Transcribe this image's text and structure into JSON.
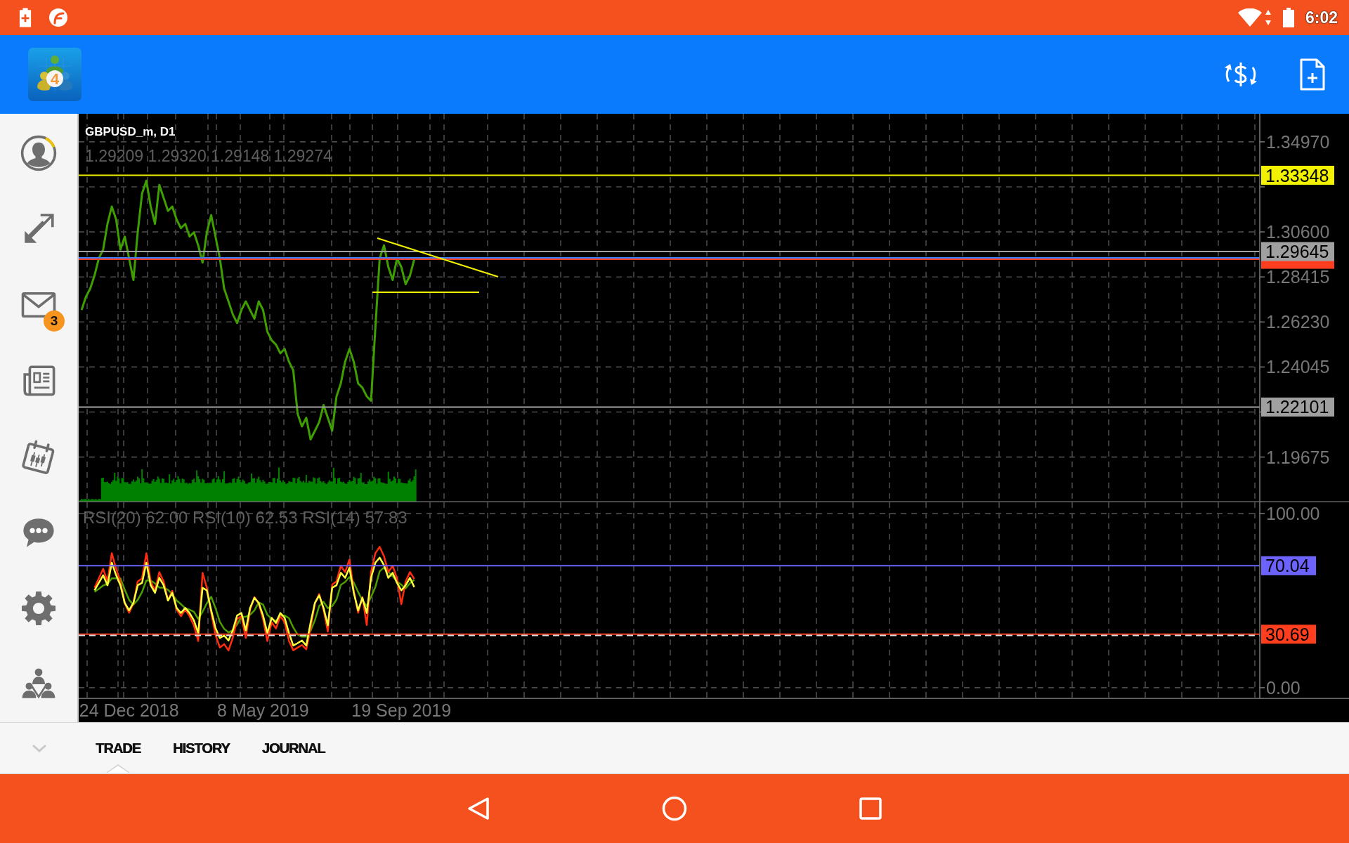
{
  "status_bar": {
    "time": "6:02"
  },
  "app_bar": {
    "logo_text": "4"
  },
  "sidebar": {
    "items": [
      {
        "kind": "account"
      },
      {
        "kind": "trade"
      },
      {
        "kind": "mail",
        "badge": "3"
      },
      {
        "kind": "news"
      },
      {
        "kind": "calendar"
      },
      {
        "kind": "chat"
      },
      {
        "kind": "settings"
      },
      {
        "kind": "community"
      }
    ]
  },
  "price_chart": {
    "ohlc": "1.29209 1.29320 1.29148 1.29274",
    "chart_data": {
      "type": "line",
      "title": "GBPUSD_m, D1",
      "grid": true,
      "ylim": [
        1.1748,
        1.3633
      ],
      "yticks": [
        {
          "value": 1.3497,
          "label": "1.34970"
        },
        {
          "value": 1.306,
          "label": "1.30600"
        },
        {
          "value": 1.28415,
          "label": "1.28415"
        },
        {
          "value": 1.2623,
          "label": "1.26230"
        },
        {
          "value": 1.24045,
          "label": "1.24045"
        },
        {
          "value": 1.19675,
          "label": "1.19675"
        }
      ],
      "categories": [
        null,
        null,
        null,
        null,
        null,
        null,
        null,
        null,
        null,
        null,
        null,
        null,
        null,
        null,
        null,
        null,
        null,
        null,
        null,
        null,
        null,
        null,
        null,
        null,
        null,
        null,
        null,
        null,
        null,
        null,
        null,
        null,
        null,
        null,
        null,
        null,
        null,
        null,
        null,
        null,
        null,
        null,
        null,
        null,
        null,
        null,
        null,
        null,
        null,
        null,
        null,
        null,
        null,
        null,
        null,
        null,
        null,
        null,
        null,
        null,
        null,
        null,
        null,
        null,
        null,
        null,
        null,
        null,
        null,
        null,
        null,
        null,
        null,
        null,
        null,
        null,
        null,
        null,
        null,
        null,
        null,
        null,
        null,
        null,
        null,
        null,
        null,
        null,
        null,
        null,
        null,
        null,
        null,
        null,
        null,
        null,
        null,
        null,
        null,
        null,
        null,
        null,
        null,
        null,
        null,
        null,
        null,
        null,
        null,
        null,
        null,
        null,
        null,
        null,
        null,
        null,
        null,
        null,
        null,
        null,
        null,
        null,
        null,
        null,
        null,
        null,
        null,
        null,
        null,
        null,
        null,
        null,
        null,
        null,
        null,
        null,
        null,
        null,
        null,
        null,
        null,
        null,
        null,
        null,
        null,
        null,
        null,
        null,
        null,
        null,
        null,
        null,
        null,
        null,
        null,
        null,
        null,
        null,
        null,
        null,
        null,
        null,
        null,
        null,
        null,
        null,
        null,
        null,
        null,
        null,
        null,
        null,
        null,
        null,
        null,
        null,
        null,
        null,
        null,
        null,
        null,
        null,
        null,
        null,
        null,
        null,
        null,
        null,
        null,
        null,
        null,
        null,
        null,
        null,
        null,
        null,
        null,
        null,
        null,
        null,
        null,
        null,
        null,
        null,
        null,
        null,
        null,
        null,
        null,
        null,
        null,
        null,
        null,
        null,
        null,
        null,
        null,
        null,
        null,
        null,
        null,
        null,
        null,
        null,
        null,
        null,
        null,
        null,
        null,
        null,
        null,
        null,
        null,
        null,
        null,
        null,
        null,
        null,
        null,
        null,
        null,
        null,
        null,
        null,
        null,
        null,
        null,
        null,
        null,
        null,
        null,
        null,
        null,
        null,
        null,
        null,
        null,
        null,
        null,
        null,
        null,
        null,
        null,
        null,
        null,
        null,
        null,
        null,
        null,
        null,
        null,
        null,
        null
      ],
      "series": [
        {
          "color": "#3f9f00",
          "values": [
            1.2681,
            1.2744,
            1.2785,
            1.2848,
            1.2932,
            1.2974,
            1.3099,
            1.3183,
            1.312,
            1.2974,
            1.3037,
            1.2932,
            1.2827,
            1.3058,
            1.3246,
            1.3309,
            1.3183,
            1.3099,
            1.3288,
            1.3225,
            1.3162,
            1.3183,
            1.312,
            1.3078,
            1.3099,
            1.3037,
            1.3058,
            1.2995,
            1.2911,
            1.3058,
            1.3141,
            1.3037,
            1.2932,
            1.2785,
            1.2723,
            1.266,
            1.2618,
            1.2681,
            1.2723,
            1.2681,
            1.2639,
            1.2723,
            1.2681,
            1.2576,
            1.2534,
            1.2513,
            1.2471,
            1.2492,
            1.243,
            1.2388,
            1.2178,
            1.2116,
            1.2158,
            1.2053,
            1.2095,
            1.2137,
            1.222,
            1.2158,
            1.2095,
            1.2262,
            1.2325,
            1.243,
            1.2492,
            1.243,
            1.2325,
            1.2304,
            1.2262,
            1.2241,
            1.2597,
            1.2932,
            1.2995,
            1.289,
            1.2827,
            1.2932,
            1.289,
            1.2806,
            1.2848,
            1.2927,
            null,
            null,
            null,
            null,
            null,
            null,
            null,
            null,
            null,
            null,
            null,
            null,
            null,
            null,
            null,
            null,
            null,
            null,
            null,
            null,
            null,
            null,
            null,
            null,
            null,
            null,
            null,
            null,
            null,
            null,
            null,
            null,
            null,
            null,
            null,
            null,
            null,
            null,
            null,
            null,
            null,
            null,
            null,
            null,
            null,
            null,
            null,
            null,
            null,
            null,
            null,
            null,
            null,
            null,
            null,
            null,
            null,
            null,
            null,
            null,
            null,
            null,
            null,
            null,
            null,
            null,
            null,
            null,
            null,
            null,
            null,
            null,
            null,
            null,
            null,
            null,
            null,
            null,
            null,
            null,
            null,
            null,
            null,
            null,
            null,
            null,
            null,
            null,
            null,
            null,
            null,
            null,
            null,
            null,
            null,
            null,
            null,
            null,
            null,
            null,
            null,
            null,
            null,
            null,
            null,
            null,
            null,
            null,
            null,
            null,
            null,
            null,
            null,
            null,
            null,
            null,
            null,
            null,
            null,
            null,
            null,
            null,
            null,
            null,
            null,
            null,
            null,
            null,
            null,
            null,
            null,
            null,
            null,
            null,
            null,
            null,
            null,
            null,
            null,
            null,
            null,
            null,
            null,
            null,
            null,
            null,
            null,
            null,
            null,
            null,
            null,
            null,
            null,
            null,
            null,
            null,
            null,
            null,
            null,
            null,
            null,
            null,
            null,
            null,
            null,
            null,
            null,
            null,
            null,
            null,
            null,
            null,
            null,
            null,
            null,
            null,
            null,
            null,
            null,
            null,
            null,
            null,
            null,
            null,
            null,
            null,
            null,
            null,
            null,
            null,
            null,
            null,
            null,
            null,
            null
          ]
        }
      ],
      "ref_lines": [
        {
          "axis": "y",
          "value": 1.33348,
          "color": "#f2f200",
          "label": "1.33348"
        },
        {
          "axis": "y",
          "value": 1.2934,
          "color": "#3a7bff"
        },
        {
          "axis": "y",
          "value": 1.29274,
          "color": "#ff3d1f"
        },
        {
          "axis": "y",
          "value": 1.29645,
          "color": "#a0a0a0",
          "label": "1.29645"
        },
        {
          "axis": "y",
          "value": 1.22101,
          "color": "#a0a0a0",
          "label": "1.22101"
        }
      ]
    }
  },
  "indicator_chart": {
    "chart_data": {
      "type": "line",
      "title": "RSI(20) 62.00 RSI(10) 62.53 RSI(14) 57.83",
      "grid": true,
      "ylim": [
        -6.5,
        106.5
      ],
      "yticks": [
        {
          "value": 100,
          "label": "100.00"
        },
        {
          "value": 0,
          "label": "0.00"
        }
      ],
      "categories": [
        null,
        null,
        null,
        null,
        null,
        null,
        null,
        null,
        null,
        null,
        null,
        "24 Dec 2018",
        null,
        null,
        null,
        null,
        null,
        null,
        null,
        null,
        null,
        null,
        null,
        null,
        null,
        null,
        null,
        null,
        null,
        null,
        null,
        null,
        null,
        null,
        null,
        null,
        null,
        null,
        null,
        null,
        null,
        null,
        "8 May 2019",
        null,
        null,
        null,
        null,
        null,
        null,
        null,
        null,
        null,
        null,
        null,
        null,
        null,
        null,
        null,
        null,
        null,
        null,
        null,
        null,
        null,
        null,
        null,
        null,
        null,
        null,
        null,
        null,
        null,
        null,
        null,
        "19 Sep 2019",
        null,
        null,
        null,
        null,
        null,
        null,
        null,
        null,
        null,
        null,
        null,
        null,
        null,
        null,
        null,
        null,
        null,
        null,
        null,
        null,
        null,
        null,
        null,
        null,
        null,
        null,
        null,
        null,
        null,
        null,
        null,
        null,
        null,
        null,
        null,
        null,
        null,
        null,
        null,
        null,
        null,
        null,
        null,
        null,
        null,
        null,
        null,
        null,
        null,
        null,
        null,
        null,
        null,
        null,
        null,
        null,
        null,
        null,
        null,
        null,
        null,
        null,
        null,
        null,
        null,
        null,
        null,
        null,
        null,
        null,
        null,
        null,
        null,
        null,
        null,
        null,
        null,
        null,
        null,
        null,
        null,
        null,
        null,
        null,
        null,
        null,
        null,
        null,
        null,
        null,
        null,
        null,
        null,
        null,
        null,
        null,
        null,
        null,
        null,
        null,
        null,
        null,
        null,
        null,
        null,
        null,
        null,
        null,
        null,
        null,
        null,
        null,
        null,
        null,
        null,
        null,
        null,
        null,
        null,
        null,
        null,
        null,
        null,
        null,
        null,
        null,
        null,
        null,
        null,
        null,
        null,
        null,
        null,
        null,
        null,
        null,
        null,
        null,
        null,
        null,
        null,
        null,
        null,
        null,
        null,
        null,
        null,
        null,
        null,
        null,
        null,
        null,
        null,
        null,
        null,
        null,
        null,
        null,
        null,
        null,
        null,
        null,
        null,
        null,
        null,
        null,
        null,
        null,
        null,
        null,
        null,
        null,
        null,
        null,
        null,
        null,
        null,
        null,
        null,
        null,
        null,
        null,
        null,
        null,
        null,
        null,
        null,
        null,
        null,
        null,
        null,
        null,
        null,
        null,
        null,
        null,
        null,
        null
      ],
      "series": [
        {
          "color": "#4d9e00",
          "values": [
            null,
            null,
            null,
            55.0,
            56.8,
            58.7,
            59.5,
            62.8,
            62.8,
            62.8,
            56.3,
            50.5,
            47.7,
            50.5,
            55.0,
            61.6,
            61.6,
            59.9,
            57.5,
            57.5,
            56.2,
            53.8,
            50.1,
            48.0,
            45.6,
            44.8,
            43.6,
            39.5,
            43.6,
            48.5,
            52.2,
            45.7,
            37.8,
            33.8,
            31.7,
            33.0,
            36.3,
            40.7,
            40.7,
            41.9,
            44.4,
            48.9,
            47.7,
            41.9,
            39.5,
            38.3,
            41.5,
            41.5,
            39.9,
            34.6,
            30.5,
            29.3,
            29.3,
            32.6,
            38.7,
            46.9,
            49.3,
            45.7,
            46.9,
            50.6,
            59.1,
            60.7,
            63.6,
            60.4,
            55.0,
            50.2,
            46.9,
            52.1,
            57.9,
            66.9,
            69.0,
            66.5,
            64.0,
            61.1,
            59.1,
            57.1,
            60.0,
            62.0,
            null,
            null,
            null,
            null,
            null,
            null,
            null,
            null,
            null,
            null,
            null,
            null,
            null,
            null,
            null,
            null,
            null,
            null,
            null,
            null,
            null,
            null,
            null,
            null,
            null,
            null,
            null,
            null,
            null,
            null,
            null,
            null,
            null,
            null,
            null,
            null,
            null,
            null,
            null,
            null,
            null,
            null,
            null,
            null,
            null,
            null,
            null,
            null,
            null,
            null,
            null,
            null,
            null,
            null,
            null,
            null,
            null,
            null,
            null,
            null,
            null,
            null,
            null,
            null,
            null,
            null,
            null,
            null,
            null,
            null,
            null,
            null,
            null,
            null,
            null,
            null,
            null,
            null,
            null,
            null,
            null,
            null,
            null,
            null,
            null,
            null,
            null,
            null,
            null,
            null,
            null,
            null,
            null,
            null,
            null,
            null,
            null,
            null,
            null,
            null,
            null,
            null,
            null,
            null,
            null,
            null,
            null,
            null,
            null,
            null,
            null,
            null,
            null,
            null,
            null,
            null,
            null,
            null,
            null,
            null,
            null,
            null,
            null,
            null,
            null,
            null,
            null,
            null,
            null,
            null,
            null,
            null,
            null,
            null,
            null,
            null,
            null,
            null,
            null,
            null,
            null,
            null,
            null,
            null,
            null,
            null,
            null,
            null,
            null,
            null,
            null,
            null,
            null,
            null,
            null,
            null,
            null,
            null,
            null,
            null,
            null,
            null,
            null,
            null,
            null,
            null,
            null,
            null,
            null,
            null,
            null,
            null,
            null,
            null,
            null,
            null,
            null,
            null,
            null,
            null,
            null,
            null,
            null,
            null,
            null,
            null,
            null,
            null,
            null,
            null,
            null,
            null,
            null,
            null,
            null
          ]
        },
        {
          "color": "#ff2d0f",
          "values": [
            null,
            null,
            null,
            57.4,
            62.8,
            68.3,
            61.0,
            77.3,
            68.3,
            61.0,
            48.4,
            43.0,
            48.4,
            61.0,
            62.8,
            77.3,
            61.0,
            55.6,
            66.4,
            61.0,
            50.1,
            55.6,
            44.8,
            41.1,
            44.8,
            41.1,
            35.8,
            26.8,
            66.0,
            57.4,
            43.0,
            30.4,
            23.1,
            25.0,
            21.4,
            28.6,
            39.4,
            41.1,
            28.6,
            44.8,
            52.0,
            48.4,
            39.4,
            26.8,
            37.6,
            34.0,
            41.1,
            37.6,
            26.8,
            21.5,
            23.0,
            24.5,
            22.0,
            34.0,
            48.4,
            53.8,
            44.8,
            32.3,
            59.3,
            61.0,
            70.0,
            66.4,
            73.6,
            55.6,
            43.0,
            52.0,
            36.0,
            66.4,
            77.3,
            80.9,
            75.4,
            66.4,
            70.0,
            62.8,
            48.0,
            61.0,
            66.4,
            62.5,
            null,
            null,
            null,
            null,
            null,
            null,
            null,
            null,
            null,
            null,
            null,
            null,
            null,
            null,
            null,
            null,
            null,
            null,
            null,
            null,
            null,
            null,
            null,
            null,
            null,
            null,
            null,
            null,
            null,
            null,
            null,
            null,
            null,
            null,
            null,
            null,
            null,
            null,
            null,
            null,
            null,
            null,
            null,
            null,
            null,
            null,
            null,
            null,
            null,
            null,
            null,
            null,
            null,
            null,
            null,
            null,
            null,
            null,
            null,
            null,
            null,
            null,
            null,
            null,
            null,
            null,
            null,
            null,
            null,
            null,
            null,
            null,
            null,
            null,
            null,
            null,
            null,
            null,
            null,
            null,
            null,
            null,
            null,
            null,
            null,
            null,
            null,
            null,
            null,
            null,
            null,
            null,
            null,
            null,
            null,
            null,
            null,
            null,
            null,
            null,
            null,
            null,
            null,
            null,
            null,
            null,
            null,
            null,
            null,
            null,
            null,
            null,
            null,
            null,
            null,
            null,
            null,
            null,
            null,
            null,
            null,
            null,
            null,
            null,
            null,
            null,
            null,
            null,
            null,
            null,
            null,
            null,
            null,
            null,
            null,
            null,
            null,
            null,
            null,
            null,
            null,
            null,
            null,
            null,
            null,
            null,
            null,
            null,
            null,
            null,
            null,
            null,
            null,
            null,
            null,
            null,
            null,
            null,
            null,
            null,
            null,
            null,
            null,
            null,
            null,
            null,
            null,
            null,
            null,
            null,
            null,
            null,
            null,
            null,
            null,
            null,
            null,
            null,
            null,
            null,
            null,
            null,
            null,
            null,
            null,
            null,
            null,
            null,
            null,
            null,
            null,
            null,
            null,
            null,
            null
          ]
        },
        {
          "color": "#ffff3c",
          "values": [
            null,
            null,
            null,
            55.9,
            60.2,
            64.6,
            58.8,
            71.8,
            64.6,
            58.8,
            48.7,
            44.4,
            48.7,
            58.8,
            60.2,
            71.8,
            58.8,
            54.5,
            63.1,
            58.8,
            50.1,
            54.5,
            45.8,
            42.9,
            45.8,
            42.9,
            38.6,
            31.4,
            57.4,
            55.9,
            44.4,
            34.3,
            28.5,
            30.0,
            27.1,
            32.9,
            41.5,
            42.9,
            32.9,
            45.8,
            51.6,
            48.7,
            41.5,
            31.4,
            40.1,
            37.2,
            42.9,
            40.1,
            31.4,
            24.2,
            25.6,
            27.1,
            24.2,
            37.2,
            48.7,
            53.0,
            45.8,
            35.8,
            57.4,
            58.8,
            66.0,
            63.1,
            68.9,
            54.5,
            44.4,
            51.6,
            42.9,
            63.1,
            71.8,
            74.7,
            70.3,
            63.1,
            66.0,
            60.2,
            55.9,
            58.8,
            63.1,
            57.8,
            null,
            null,
            null,
            null,
            null,
            null,
            null,
            null,
            null,
            null,
            null,
            null,
            null,
            null,
            null,
            null,
            null,
            null,
            null,
            null,
            null,
            null,
            null,
            null,
            null,
            null,
            null,
            null,
            null,
            null,
            null,
            null,
            null,
            null,
            null,
            null,
            null,
            null,
            null,
            null,
            null,
            null,
            null,
            null,
            null,
            null,
            null,
            null,
            null,
            null,
            null,
            null,
            null,
            null,
            null,
            null,
            null,
            null,
            null,
            null,
            null,
            null,
            null,
            null,
            null,
            null,
            null,
            null,
            null,
            null,
            null,
            null,
            null,
            null,
            null,
            null,
            null,
            null,
            null,
            null,
            null,
            null,
            null,
            null,
            null,
            null,
            null,
            null,
            null,
            null,
            null,
            null,
            null,
            null,
            null,
            null,
            null,
            null,
            null,
            null,
            null,
            null,
            null,
            null,
            null,
            null,
            null,
            null,
            null,
            null,
            null,
            null,
            null,
            null,
            null,
            null,
            null,
            null,
            null,
            null,
            null,
            null,
            null,
            null,
            null,
            null,
            null,
            null,
            null,
            null,
            null,
            null,
            null,
            null,
            null,
            null,
            null,
            null,
            null,
            null,
            null,
            null,
            null,
            null,
            null,
            null,
            null,
            null,
            null,
            null,
            null,
            null,
            null,
            null,
            null,
            null,
            null,
            null,
            null,
            null,
            null,
            null,
            null,
            null,
            null,
            null,
            null,
            null,
            null,
            null,
            null,
            null,
            null,
            null,
            null,
            null,
            null,
            null,
            null,
            null,
            null,
            null,
            null,
            null,
            null,
            null,
            null,
            null,
            null,
            null,
            null,
            null,
            null,
            null,
            null
          ]
        }
      ],
      "ref_lines": [
        {
          "axis": "y",
          "value": 70.04,
          "color": "#6c63ff",
          "label": "70.04"
        },
        {
          "axis": "y",
          "value": 30.69,
          "color": "#ff3d1f",
          "label": "30.69"
        },
        {
          "axis": "y",
          "value": 30,
          "color": "#dddddd"
        }
      ]
    }
  },
  "bottom_tabs": {
    "tabs": [
      {
        "label": "TRADE",
        "selected": true
      },
      {
        "label": "HISTORY",
        "selected": false
      },
      {
        "label": "JOURNAL",
        "selected": false
      }
    ]
  }
}
